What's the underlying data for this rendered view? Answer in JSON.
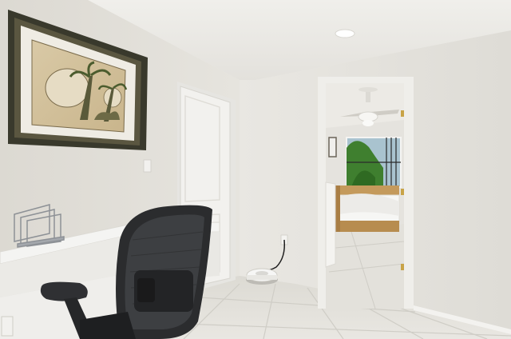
{
  "scene": {
    "subject": "home-office-hallway-photo",
    "colors": {
      "ceiling": "#ecebe7",
      "left_wall": "#e4e2dc",
      "right_wall": "#ebe9e4",
      "floor_tile": "#e2e0da",
      "grout": "#cfcdc6",
      "door": "#f2f1ee",
      "frame": "#3a3a2c",
      "chair": "#2b2c2e",
      "desk": "#f3f3f1",
      "bed_wood": "#c49a5c",
      "window_green": "#3f7f2f",
      "sky": "#a9c3cf"
    }
  }
}
